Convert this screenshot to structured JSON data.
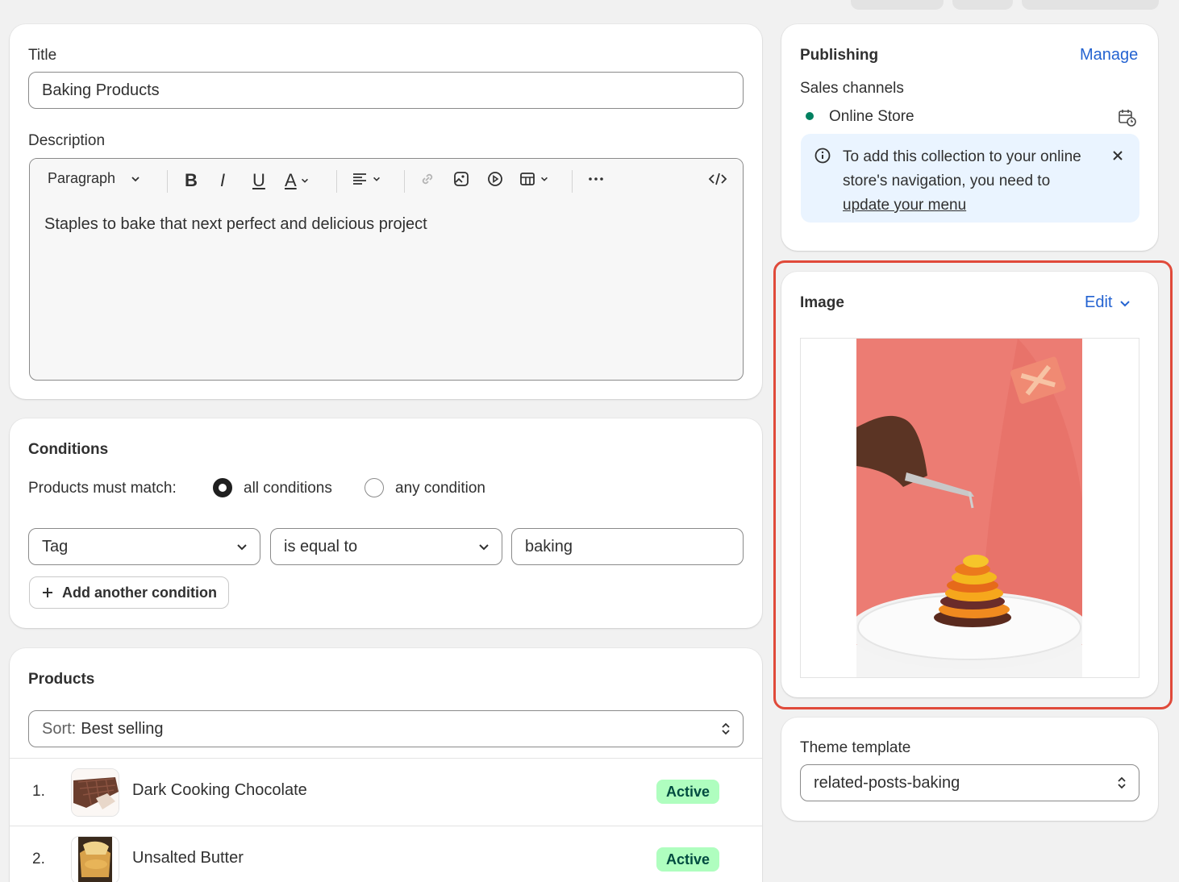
{
  "title_card": {
    "title_label": "Title",
    "title_value": "Baking Products",
    "description_label": "Description",
    "toolbar": {
      "paragraph_label": "Paragraph"
    },
    "description_value": "Staples to bake that next perfect and delicious project"
  },
  "conditions": {
    "heading": "Conditions",
    "match_label": "Products must match:",
    "all_option": "all conditions",
    "any_option": "any condition",
    "selected": "all conditions",
    "field": "Tag",
    "operator": "is equal to",
    "value": "baking",
    "add_button": "Add another condition"
  },
  "products": {
    "heading": "Products",
    "sort_prefix": "Sort:",
    "sort_value": "Best selling",
    "items": [
      {
        "num": "1.",
        "name": "Dark Cooking Chocolate",
        "status": "Active"
      },
      {
        "num": "2.",
        "name": "Unsalted Butter",
        "status": "Active"
      }
    ]
  },
  "publishing": {
    "heading": "Publishing",
    "manage": "Manage",
    "channels_label": "Sales channels",
    "channel": "Online Store",
    "banner_text_1": "To add this collection to your online store's navigation, you need to ",
    "banner_link": "update your menu"
  },
  "image_card": {
    "heading": "Image",
    "edit": "Edit"
  },
  "theme": {
    "label": "Theme template",
    "value": "related-posts-baking"
  },
  "colors": {
    "accent_link": "#2463d1",
    "active_badge_bg": "#affebf",
    "active_badge_text": "#014b40",
    "channel_dot": "#008060",
    "banner_bg": "#eaf4ff",
    "highlight_border": "#e04a3a"
  }
}
